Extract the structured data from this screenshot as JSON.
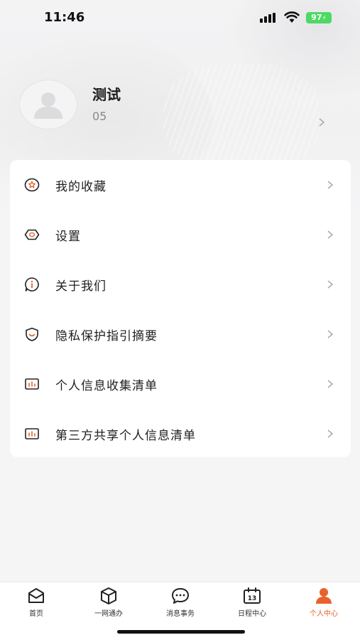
{
  "status_bar": {
    "time": "11:46",
    "battery": "97"
  },
  "profile": {
    "name": "测试",
    "id": "05"
  },
  "menu": [
    {
      "label": "我的收藏",
      "icon": "star-badge-icon"
    },
    {
      "label": "设置",
      "icon": "settings-hexagon-icon"
    },
    {
      "label": "关于我们",
      "icon": "info-bubble-icon"
    },
    {
      "label": "隐私保护指引摘要",
      "icon": "shield-smile-icon"
    },
    {
      "label": "个人信息收集清单",
      "icon": "bar-chart-box-icon"
    },
    {
      "label": "第三方共享个人信息清单",
      "icon": "bar-chart-box-icon"
    }
  ],
  "tabs": [
    {
      "label": "首页",
      "icon": "home-envelope-icon",
      "active": false
    },
    {
      "label": "一网通办",
      "icon": "cube-icon",
      "active": false
    },
    {
      "label": "消息事务",
      "icon": "chat-bubble-icon",
      "active": false
    },
    {
      "label": "日程中心",
      "icon": "calendar-icon",
      "active": false
    },
    {
      "label": "个人中心",
      "icon": "person-icon",
      "active": true
    }
  ],
  "colors": {
    "accent": "#e8622c",
    "battery": "#4cd964",
    "card": "#ffffff"
  }
}
